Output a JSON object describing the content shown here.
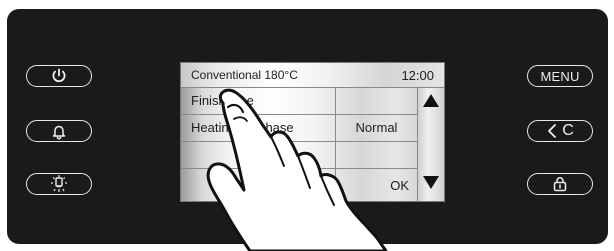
{
  "header": {
    "mode": "Conventional 180°C",
    "time": "12:00"
  },
  "menu": {
    "rows": [
      {
        "label": "Finish time",
        "value": ""
      },
      {
        "label": "Heating-up phase",
        "value": "Normal"
      },
      {
        "label": "",
        "value": ""
      },
      {
        "label": "",
        "value": "OK"
      }
    ]
  },
  "buttons": {
    "menu_label": "MENU",
    "back_label": "C"
  },
  "icons": {
    "power": "power-icon",
    "bell": "bell-icon",
    "lamp": "lamp-icon",
    "back": "chevron-left-icon",
    "lock": "lock-icon"
  },
  "colors": {
    "panel": "#1a1a1a",
    "buttonOutline": "#e7e7e7",
    "screen": "#f3f3f3",
    "text": "#1d1d1d"
  }
}
